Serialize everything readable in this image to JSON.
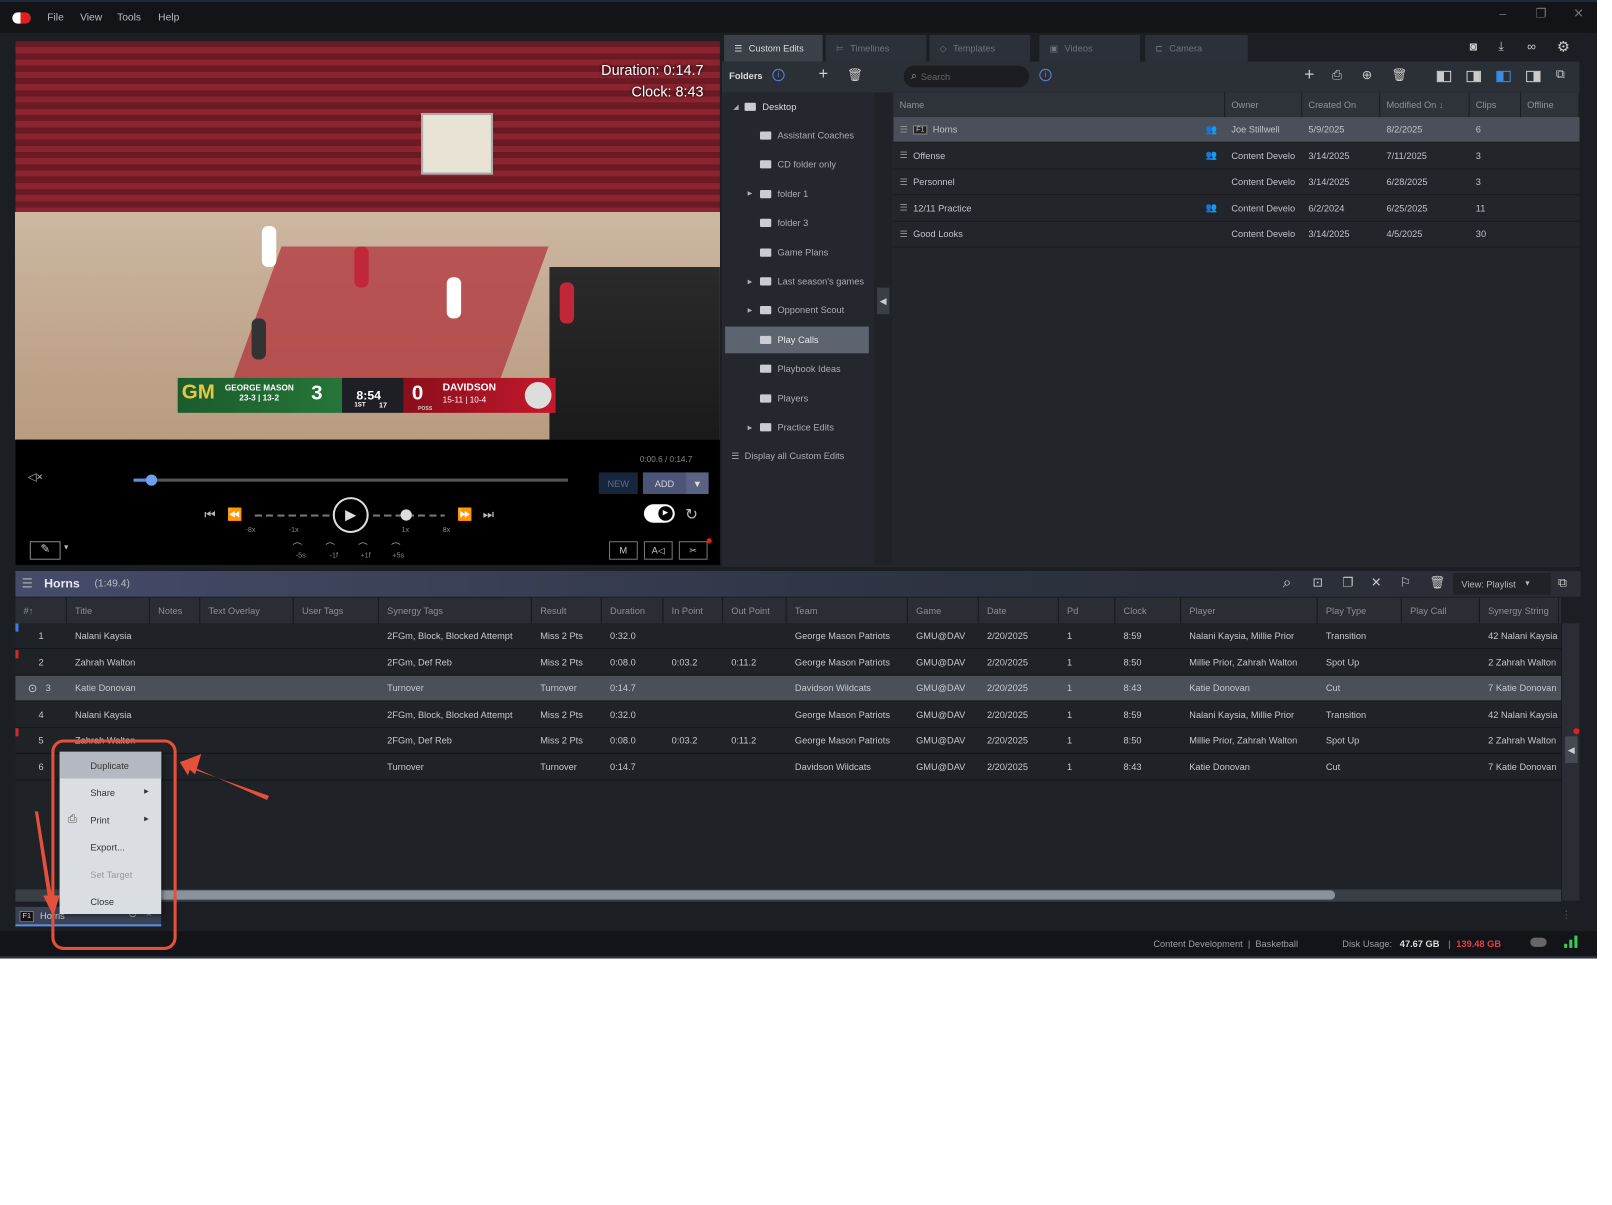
{
  "menu": {
    "items": [
      "File",
      "View",
      "Tools",
      "Help"
    ]
  },
  "window_controls": {
    "minimize": "–",
    "restore": "❐",
    "close": "✕"
  },
  "video": {
    "duration": "Duration: 0:14.7",
    "clock": "Clock: 8:43",
    "scoreboard": {
      "home_logo": "GM",
      "home_name": "GEORGE MASON",
      "home_record": "23-3 | 13-2",
      "home_score": "3",
      "game_clock": "8:54",
      "period": "1ST",
      "shot_clock": "17",
      "away_score": "0",
      "away_name": "DAVIDSON",
      "away_record": "15-11 | 10-4",
      "poss": "POSS"
    }
  },
  "player_controls": {
    "time": "0:00.6 / 0:14.7",
    "seek_fraction": 0.04,
    "new_label": "NEW",
    "add_label": "ADD",
    "speed_labels": [
      "-8x",
      "-1x",
      "1x",
      "8x"
    ],
    "step_labels": [
      "-5s",
      "-1f",
      "+1f",
      "+5s"
    ],
    "mode_buttons": [
      "M",
      "A◁"
    ]
  },
  "tabs": [
    {
      "label": "Custom Edits",
      "active": true
    },
    {
      "label": "Timelines"
    },
    {
      "label": "Templates"
    },
    {
      "label": "Videos"
    },
    {
      "label": "Camera"
    }
  ],
  "folders_panel": {
    "title": "Folders",
    "search_placeholder": "Search",
    "root": "Desktop",
    "items": [
      {
        "label": "Assistant Coaches",
        "expandable": false
      },
      {
        "label": "CD folder only",
        "expandable": false
      },
      {
        "label": "folder 1",
        "expandable": true
      },
      {
        "label": "folder 3",
        "expandable": false
      },
      {
        "label": "Game Plans",
        "expandable": false
      },
      {
        "label": "Last season's games",
        "expandable": true
      },
      {
        "label": "Opponent Scout",
        "expandable": true
      },
      {
        "label": "Play Calls",
        "expandable": false,
        "selected": true
      },
      {
        "label": "Playbook Ideas",
        "expandable": false
      },
      {
        "label": "Players",
        "expandable": false
      },
      {
        "label": "Practice Edits",
        "expandable": true
      }
    ],
    "display_all": "Display all Custom Edits"
  },
  "edits_list": {
    "columns": [
      "Name",
      "Owner",
      "Created On",
      "Modified On ↓",
      "Clips",
      "Offline"
    ],
    "rows": [
      {
        "badge": "F1",
        "name": "Horns",
        "shared": true,
        "owner": "Joe Stillwell",
        "created": "5/9/2025",
        "modified": "8/2/2025",
        "clips": "6",
        "selected": true
      },
      {
        "name": "Offense",
        "shared": true,
        "owner": "Content Develo",
        "created": "3/14/2025",
        "modified": "7/11/2025",
        "clips": "3"
      },
      {
        "name": "Personnel",
        "shared": false,
        "owner": "Content Develo",
        "created": "3/14/2025",
        "modified": "6/28/2025",
        "clips": "3"
      },
      {
        "name": "12/11 Practice",
        "shared": true,
        "owner": "Content Develo",
        "created": "6/2/2024",
        "modified": "6/25/2025",
        "clips": "11"
      },
      {
        "name": "Good Looks",
        "shared": false,
        "owner": "Content Develo",
        "created": "3/14/2025",
        "modified": "4/5/2025",
        "clips": "30"
      }
    ]
  },
  "playlist": {
    "title": "Horns",
    "duration": "(1:49.4)",
    "view_label": "View: Playlist",
    "columns": [
      "#↑",
      "Title",
      "Notes",
      "Text Overlay",
      "User Tags",
      "Synergy Tags",
      "Result",
      "Duration",
      "In Point",
      "Out Point",
      "Team",
      "Game",
      "Date",
      "Pd",
      "Clock",
      "Player",
      "Play Type",
      "Play Call",
      "Synergy String"
    ],
    "rows": [
      {
        "n": "1",
        "title": "Nalani Kaysia",
        "notes": "",
        "overlay": "",
        "user_tags": "",
        "synergy_tags": "2FGm, Block, Blocked Attempt",
        "result": "Miss 2 Pts",
        "duration": "0:32.0",
        "in": "",
        "out": "",
        "team": "George Mason Patriots",
        "game": "GMU@DAV",
        "date": "2/20/2025",
        "pd": "1",
        "clock": "8:59",
        "player": "Nalani Kaysia, Millie Prior",
        "play_type": "Transition",
        "play_call": "",
        "synergy_string": "42 Nalani Kaysia",
        "marker": "#3b7be0"
      },
      {
        "n": "2",
        "title": "Zahrah Walton",
        "notes": "",
        "overlay": "",
        "user_tags": "",
        "synergy_tags": "2FGm, Def Reb",
        "result": "Miss 2 Pts",
        "duration": "0:08.0",
        "in": "0:03.2",
        "out": "0:11.2",
        "team": "George Mason Patriots",
        "game": "GMU@DAV",
        "date": "2/20/2025",
        "pd": "1",
        "clock": "8:50",
        "player": "Millie Prior, Zahrah Walton",
        "play_type": "Spot Up",
        "play_call": "",
        "synergy_string": "2 Zahrah Walton",
        "marker": "#d02a2a"
      },
      {
        "n": "3",
        "title": "Katie Donovan",
        "notes": "",
        "overlay": "",
        "user_tags": "",
        "synergy_tags": "Turnover",
        "result": "Turnover",
        "duration": "0:14.7",
        "in": "",
        "out": "",
        "team": "Davidson Wildcats",
        "game": "GMU@DAV",
        "date": "2/20/2025",
        "pd": "1",
        "clock": "8:43",
        "player": "Katie Donovan",
        "play_type": "Cut",
        "play_call": "",
        "synergy_string": "7 Katie Donovan",
        "selected": true
      },
      {
        "n": "4",
        "title": "Nalani Kaysia",
        "notes": "",
        "overlay": "",
        "user_tags": "",
        "synergy_tags": "2FGm, Block, Blocked Attempt",
        "result": "Miss 2 Pts",
        "duration": "0:32.0",
        "in": "",
        "out": "",
        "team": "George Mason Patriots",
        "game": "GMU@DAV",
        "date": "2/20/2025",
        "pd": "1",
        "clock": "8:59",
        "player": "Nalani Kaysia, Millie Prior",
        "play_type": "Transition",
        "play_call": "",
        "synergy_string": "42 Nalani Kaysia"
      },
      {
        "n": "5",
        "title": "Zahrah Walton",
        "notes": "",
        "overlay": "",
        "user_tags": "",
        "synergy_tags": "2FGm, Def Reb",
        "result": "Miss 2 Pts",
        "duration": "0:08.0",
        "in": "0:03.2",
        "out": "0:11.2",
        "team": "George Mason Patriots",
        "game": "GMU@DAV",
        "date": "2/20/2025",
        "pd": "1",
        "clock": "8:50",
        "player": "Millie Prior, Zahrah Walton",
        "play_type": "Spot Up",
        "play_call": "",
        "synergy_string": "2 Zahrah Walton",
        "marker": "#d02a2a"
      },
      {
        "n": "6",
        "title": "Katie Donovan",
        "notes": "",
        "overlay": "",
        "user_tags": "",
        "synergy_tags": "Turnover",
        "result": "Turnover",
        "duration": "0:14.7",
        "in": "",
        "out": "",
        "team": "Davidson Wildcats",
        "game": "GMU@DAV",
        "date": "2/20/2025",
        "pd": "1",
        "clock": "8:43",
        "player": "Katie Donovan",
        "play_type": "Cut",
        "play_call": "",
        "synergy_string": "7 Katie Donovan"
      }
    ],
    "bottom_tab": {
      "badge": "F1",
      "label": "Horns"
    }
  },
  "context_menu": {
    "items": [
      {
        "label": "Duplicate",
        "highlighted": true
      },
      {
        "label": "Share",
        "submenu": true
      },
      {
        "label": "Print",
        "submenu": true,
        "icon": "printer-icon"
      },
      {
        "label": "Export..."
      },
      {
        "label": "Set Target",
        "disabled": true
      },
      {
        "label": "Close"
      }
    ]
  },
  "status_bar": {
    "context": "Content Development  |  Basketball",
    "disk_label": "Disk Usage:",
    "disk_used": "47.67 GB",
    "separator": "|",
    "disk_total": "139.48 GB"
  },
  "colors": {
    "accent": "#5b8fe0",
    "annotation": "#e4503a",
    "disk_total": "#e0404a",
    "signal": "#3cc85a"
  }
}
